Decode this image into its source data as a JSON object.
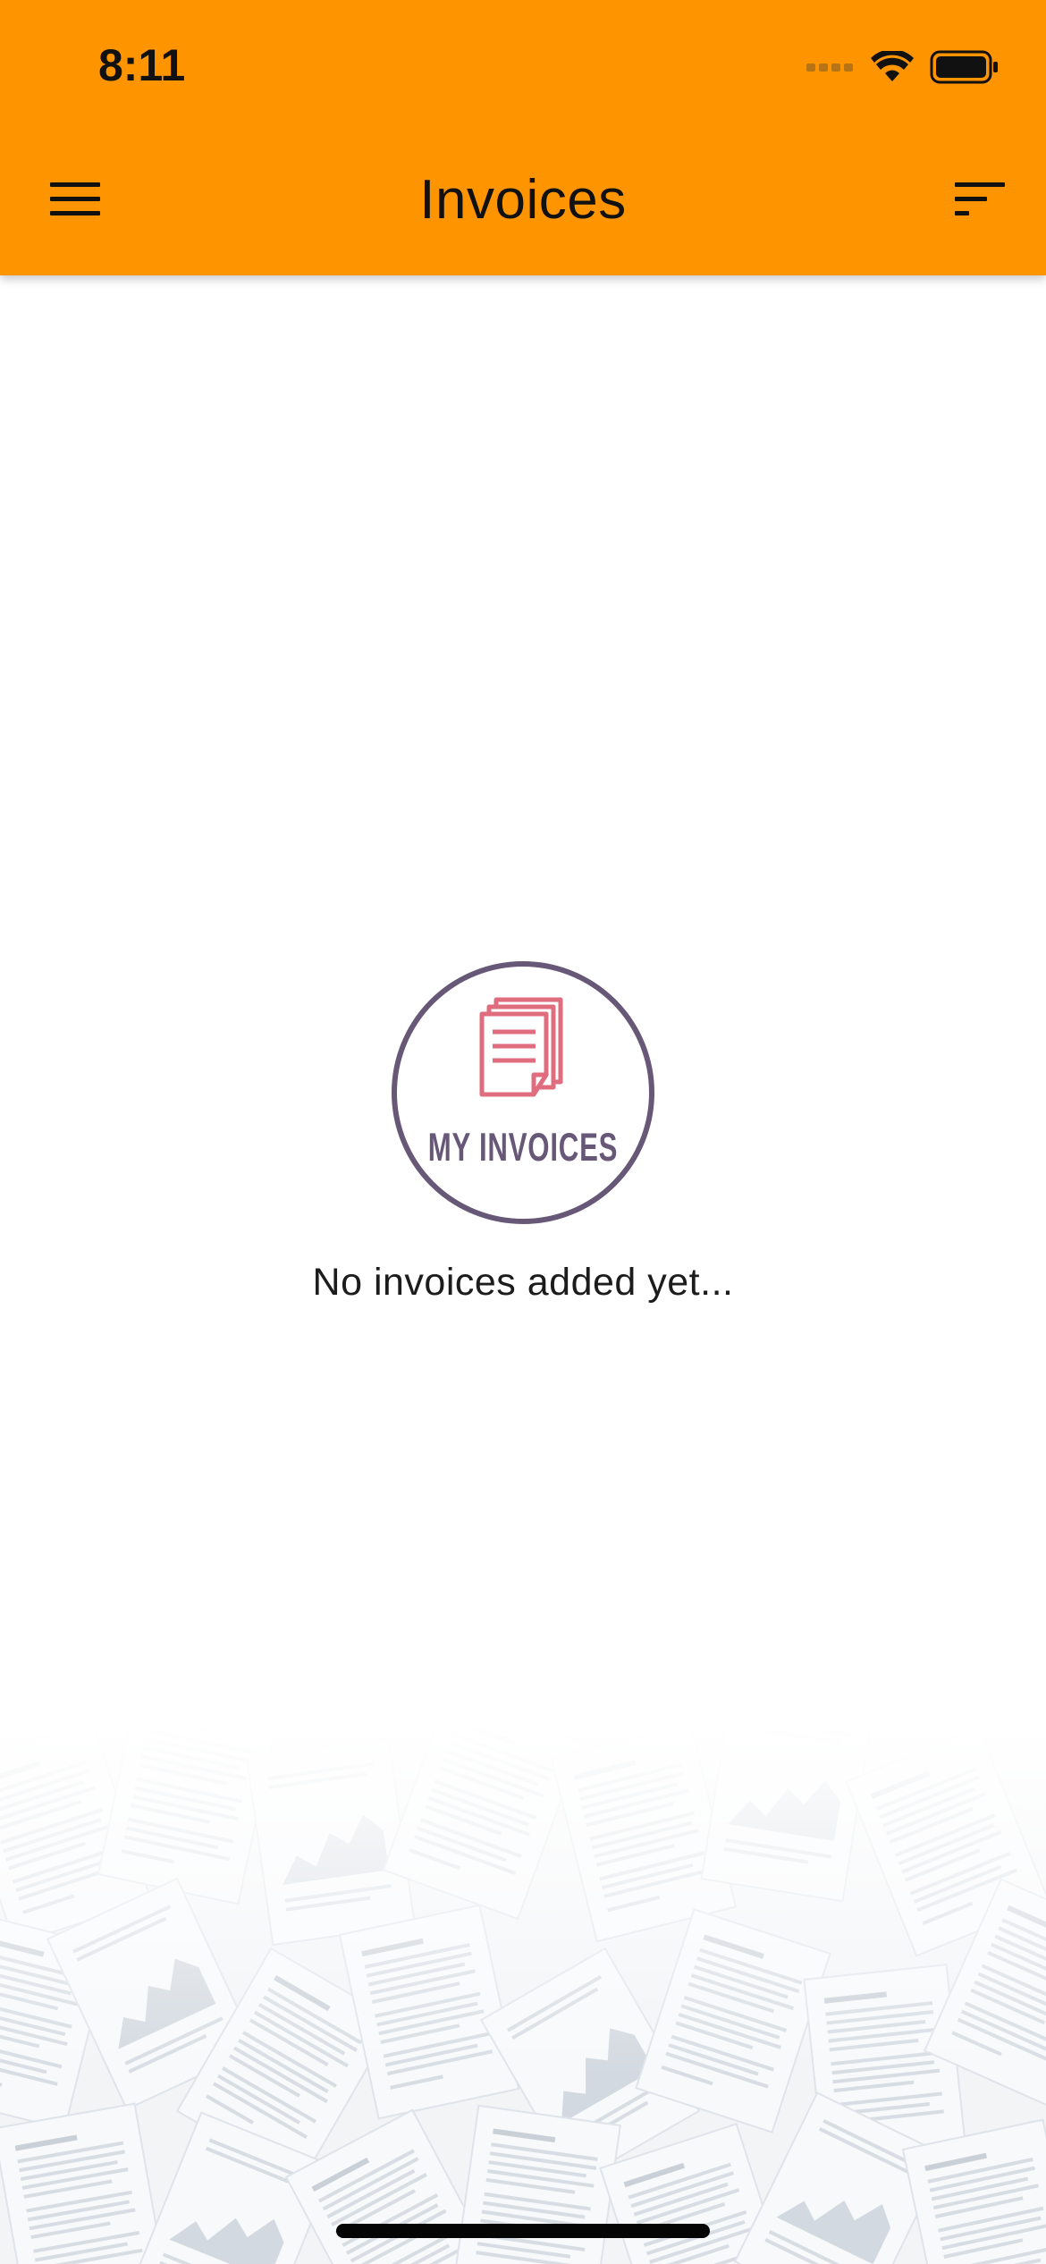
{
  "status_bar": {
    "time": "8:11",
    "icons": [
      "cellular-signal-icon",
      "wifi-icon",
      "battery-icon"
    ]
  },
  "header": {
    "title": "Invoices",
    "left_icon": "hamburger-menu-icon",
    "right_icon": "sort-filter-icon",
    "background_color": "#fe9500"
  },
  "empty_state": {
    "logo_text": "MY INVOICES",
    "logo_icon": "stacked-documents-icon",
    "message": "No invoices added yet...",
    "logo_ring_color": "#675877",
    "logo_accent_color": "#e06d7e"
  },
  "background": {
    "decoration": "scattered-papers-image"
  }
}
